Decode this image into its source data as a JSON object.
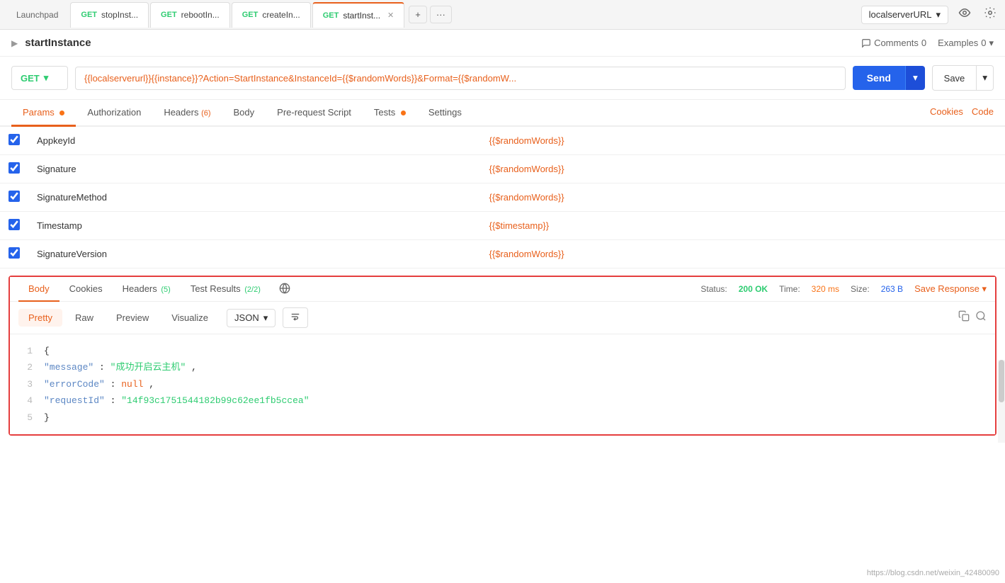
{
  "tabs": [
    {
      "id": "launchpad",
      "label": "Launchpad",
      "type": "launchpad",
      "active": false
    },
    {
      "id": "stop",
      "label": "stopInst...",
      "method": "GET",
      "active": false
    },
    {
      "id": "reboot",
      "label": "rebootIn...",
      "method": "GET",
      "active": false
    },
    {
      "id": "create",
      "label": "createIn...",
      "method": "GET",
      "active": false
    },
    {
      "id": "start",
      "label": "startInst...",
      "method": "GET",
      "active": true,
      "closable": true
    }
  ],
  "env_select": "localserverURL",
  "request": {
    "title": "startInstance",
    "comments_label": "Comments",
    "comments_count": "0",
    "examples_label": "Examples",
    "examples_count": "0",
    "method": "GET",
    "url": "{{localserverurl}}{{instance}}?Action=StartInstance&InstanceId={{$randomWords}}&Format={{$randomW...",
    "send_label": "Send",
    "save_label": "Save"
  },
  "nav_tabs": [
    {
      "id": "params",
      "label": "Params",
      "has_dot": true,
      "active": true
    },
    {
      "id": "authorization",
      "label": "Authorization",
      "active": false
    },
    {
      "id": "headers",
      "label": "Headers",
      "badge": "(6)",
      "active": false
    },
    {
      "id": "body",
      "label": "Body",
      "active": false
    },
    {
      "id": "prerequest",
      "label": "Pre-request Script",
      "active": false
    },
    {
      "id": "tests",
      "label": "Tests",
      "has_dot": true,
      "active": false
    },
    {
      "id": "settings",
      "label": "Settings",
      "active": false
    }
  ],
  "cookies_link": "Cookies",
  "code_link": "Code",
  "params": [
    {
      "checked": true,
      "key": "AppkeyId",
      "value": "{{$randomWords}}"
    },
    {
      "checked": true,
      "key": "Signature",
      "value": "{{$randomWords}}"
    },
    {
      "checked": true,
      "key": "SignatureMethod",
      "value": "{{$randomWords}}"
    },
    {
      "checked": true,
      "key": "Timestamp",
      "value": "{{$timestamp}}"
    },
    {
      "checked": true,
      "key": "SignatureVersion",
      "value": "{{$randomWords}}"
    }
  ],
  "response": {
    "tabs": [
      {
        "id": "body",
        "label": "Body",
        "active": true
      },
      {
        "id": "cookies",
        "label": "Cookies",
        "active": false
      },
      {
        "id": "headers",
        "label": "Headers",
        "badge": "(5)",
        "active": false
      },
      {
        "id": "test_results",
        "label": "Test Results",
        "badge": "(2/2)",
        "active": false
      }
    ],
    "status_label": "Status:",
    "status_value": "200 OK",
    "time_label": "Time:",
    "time_value": "320 ms",
    "size_label": "Size:",
    "size_value": "263 B",
    "save_response": "Save Response",
    "view_tabs": [
      {
        "id": "pretty",
        "label": "Pretty",
        "active": true
      },
      {
        "id": "raw",
        "label": "Raw",
        "active": false
      },
      {
        "id": "preview",
        "label": "Preview",
        "active": false
      },
      {
        "id": "visualize",
        "label": "Visualize",
        "active": false
      }
    ],
    "format": "JSON",
    "code": [
      {
        "line": 1,
        "content": "{"
      },
      {
        "line": 2,
        "content": "\"message\": \"成功开启云主机\","
      },
      {
        "line": 3,
        "content": "\"errorCode\": null,"
      },
      {
        "line": 4,
        "content": "\"requestId\": \"14f93c1751544182b99c62ee1fb5ccea\""
      },
      {
        "line": 5,
        "content": "}"
      }
    ]
  },
  "watermark": "https://blog.csdn.net/weixin_42480090"
}
